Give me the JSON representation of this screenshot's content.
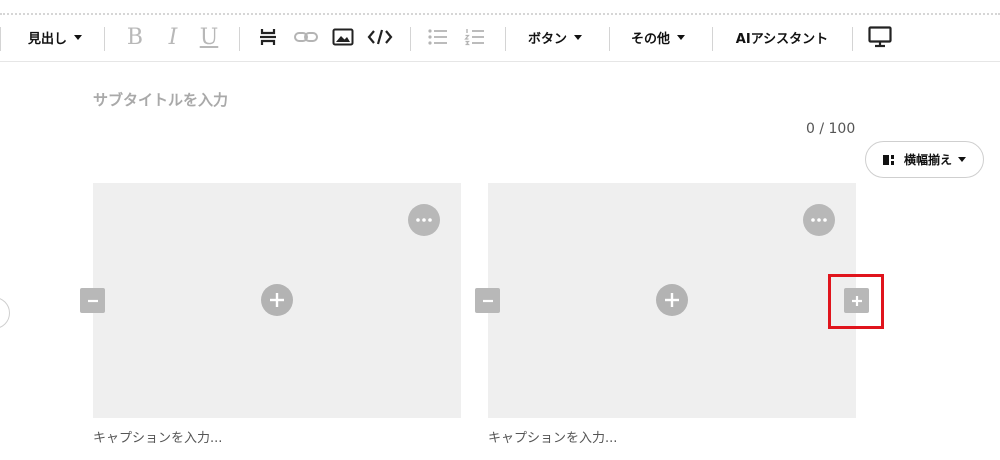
{
  "toolbar": {
    "heading_label": "見出し",
    "bold_label": "B",
    "italic_label": "I",
    "underline_label": "U",
    "icons": [
      "divider-icon",
      "link-icon",
      "image-icon",
      "code-icon",
      "bullet-list-icon",
      "numbered-list-icon",
      "monitor-icon"
    ],
    "button_label": "ボタン",
    "other_label": "その他",
    "ai_label": "AIアシスタント"
  },
  "editor": {
    "subtitle_placeholder": "サブタイトルを入力",
    "char_count": "0 / 100",
    "align_label": "横幅揃え"
  },
  "images": [
    {
      "caption_placeholder": "キャプションを入力..."
    },
    {
      "caption_placeholder": "キャプションを入力..."
    }
  ],
  "colors": {
    "highlight": "#e0141c",
    "placeholder_bg": "#efefef",
    "control_gray": "#b8b8b8"
  }
}
